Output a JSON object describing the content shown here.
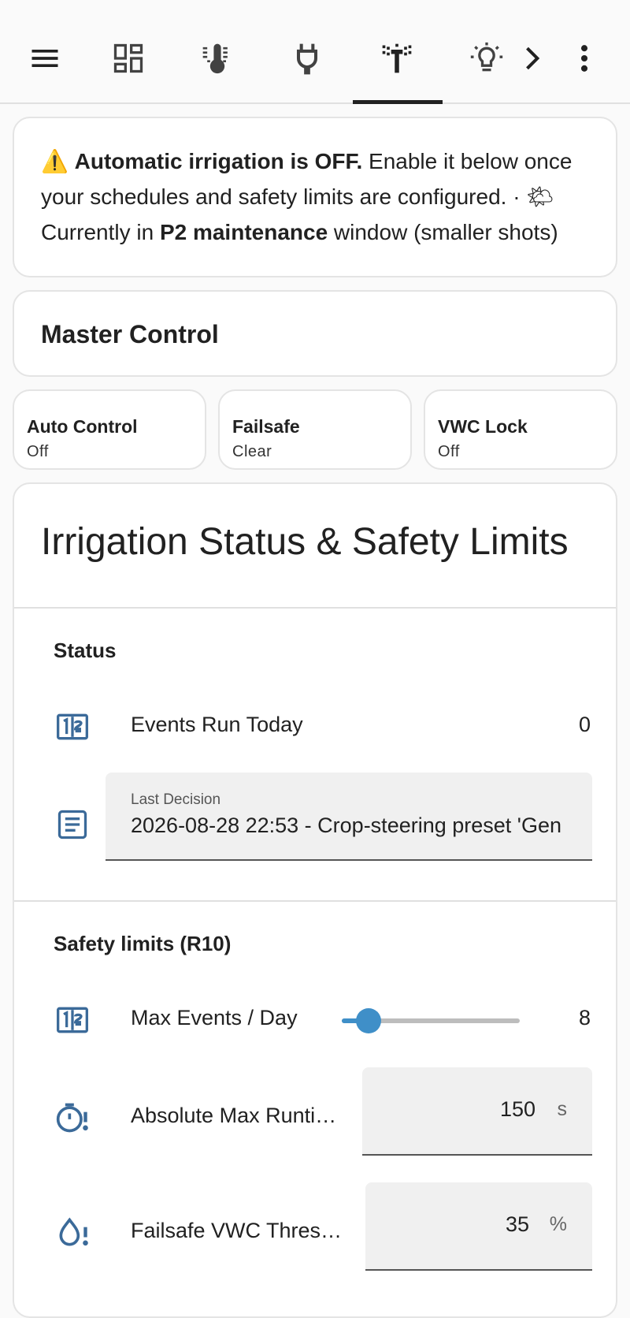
{
  "toolbar": {
    "icons": [
      "menu-icon",
      "dashboard-icon",
      "thermometer-icon",
      "plug-icon",
      "irrigation-icon",
      "lightbulb-icon",
      "chevron-right-icon",
      "more-vert-icon"
    ],
    "active_tab": "irrigation-icon"
  },
  "banner": {
    "warning_emoji": "⚠️",
    "bold1": "Automatic irrigation is OFF.",
    "text1": " Enable it below once your schedules and safety limits are configured. · ",
    "weather_emoji": "🌤",
    "text2": " Currently in ",
    "bold2": "P2 maintenance",
    "text3": " window (smaller shots)"
  },
  "master": {
    "title": "Master Control"
  },
  "tiles": [
    {
      "name": "Auto Control",
      "state": "Off"
    },
    {
      "name": "Failsafe",
      "state": "Clear"
    },
    {
      "name": "VWC Lock",
      "state": "Off"
    }
  ],
  "main": {
    "title": "Irrigation Status & Safety Limits",
    "status": {
      "title": "Status",
      "events_label": "Events Run Today",
      "events_value": "0",
      "last_decision_label": "Last Decision",
      "last_decision_value": "2026-08-28 22:53 - Crop-steering preset 'Gen"
    },
    "safety": {
      "title": "Safety limits (R10)",
      "max_events_label": "Max Events / Day",
      "max_events_value": "8",
      "max_events_fraction": 0.15,
      "abs_runtime_label": "Absolute Max Runti…",
      "abs_runtime_value": "150",
      "abs_runtime_unit": "s",
      "vwc_label": "Failsafe VWC Thres…",
      "vwc_value": "35",
      "vwc_unit": "%"
    }
  },
  "colors": {
    "accent": "#3f8fc8",
    "icon": "#3b6a99"
  }
}
